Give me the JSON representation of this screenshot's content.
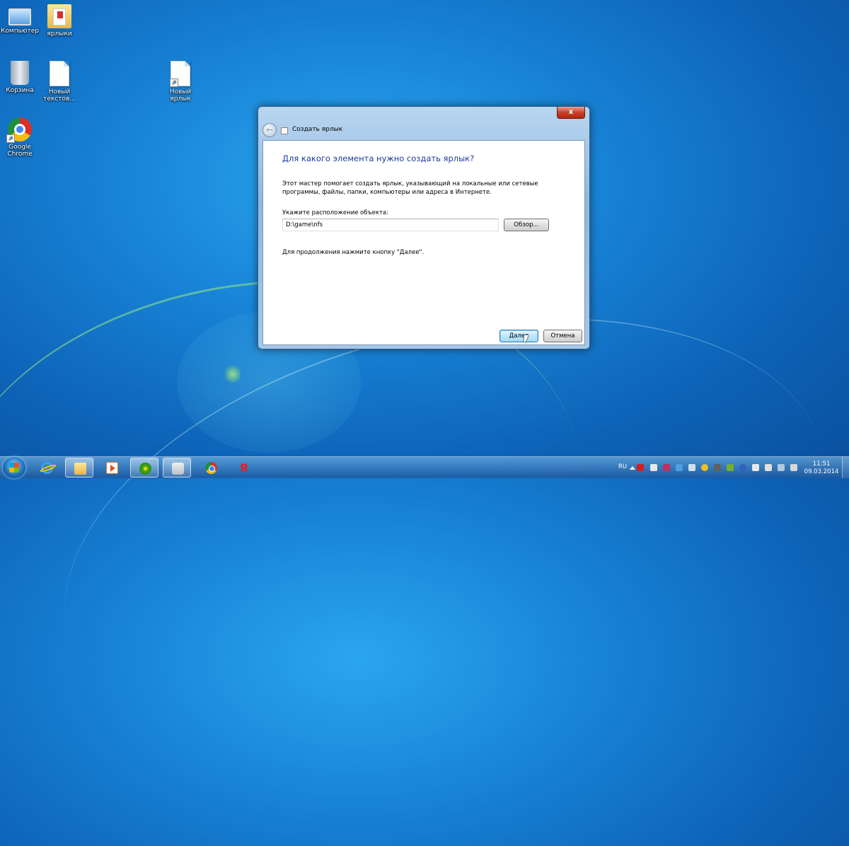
{
  "desktop": {
    "icons": [
      {
        "label": "Компьютер",
        "icon": "computer-icon"
      },
      {
        "label": "ярлыки",
        "icon": "folder-icon"
      },
      {
        "label": "Корзина",
        "icon": "recycle-bin-icon"
      },
      {
        "label": "Новый текстов...",
        "icon": "text-document-icon"
      },
      {
        "label": "Новый ярлык",
        "icon": "shortcut-icon"
      },
      {
        "label": "Google Chrome",
        "icon": "chrome-icon"
      }
    ]
  },
  "dialog": {
    "close_label": "x",
    "back_label": "←",
    "title": "Создать ярлык",
    "heading": "Для какого элемента нужно создать ярлык?",
    "description": "Этот мастер помогает создать ярлык, указывающий на локальные или сетевые программы, файлы, папки, компьютеры или адреса в Интернете.",
    "location_label": "Укажите расположение объекта:",
    "location_value": "D:\\game\\nfs",
    "browse_label": "Обзор...",
    "hint": "Для продолжения нажмите кнопку \"Далее\".",
    "next_label": "Далее",
    "cancel_label": "Отмена"
  },
  "taskbar": {
    "pinned": [
      "internet-explorer-icon",
      "explorer-icon",
      "media-player-icon",
      "icq-icon",
      "sound-icon",
      "chrome-icon",
      "yandex-icon"
    ],
    "yandex_glyph": "Я",
    "language": "RU",
    "time": "11:51",
    "date": "09.03.2014"
  },
  "colors": {
    "heading": "#1e3a9a",
    "desktop": "#1883d6",
    "close": "#c8402a"
  }
}
